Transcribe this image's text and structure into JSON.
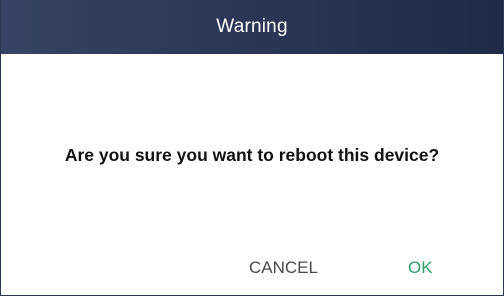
{
  "dialog": {
    "title": "Warning",
    "message": "Are you sure you want to reboot this device?",
    "cancel_label": "CANCEL",
    "ok_label": "OK"
  },
  "colors": {
    "titlebar": "#2a3552",
    "ok_accent": "#2e9d6a",
    "cancel_text": "#4a4a4a"
  }
}
